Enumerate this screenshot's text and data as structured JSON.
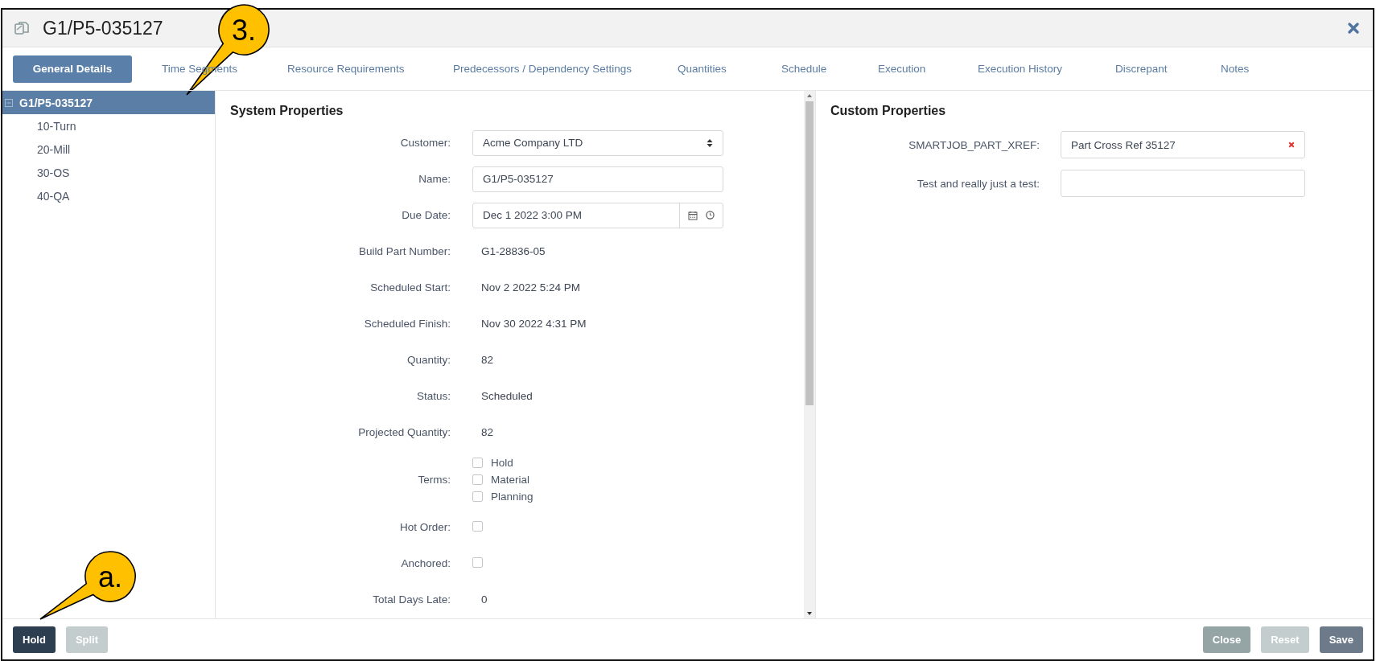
{
  "window": {
    "title": "G1/P5-035127"
  },
  "tabs": [
    {
      "label": "General Details",
      "selected": true
    },
    {
      "label": "Time Segments",
      "selected": false
    },
    {
      "label": "Resource Requirements",
      "selected": false
    },
    {
      "label": "Predecessors / Dependency Settings",
      "selected": false
    },
    {
      "label": "Quantities",
      "selected": false
    },
    {
      "label": "Schedule",
      "selected": false
    },
    {
      "label": "Execution",
      "selected": false
    },
    {
      "label": "Execution History",
      "selected": false
    },
    {
      "label": "Discrepant",
      "selected": false
    },
    {
      "label": "Notes",
      "selected": false
    }
  ],
  "tree": [
    {
      "label": "G1/P5-035127",
      "selected": true,
      "expanded": true,
      "children": [
        {
          "label": "10-Turn",
          "selected": false
        },
        {
          "label": "20-Mill",
          "selected": false
        },
        {
          "label": "30-OS",
          "selected": false
        },
        {
          "label": "40-QA",
          "selected": false
        }
      ]
    }
  ],
  "system_properties": {
    "title": "System Properties",
    "rows": [
      {
        "kind": "select",
        "label": "Customer:",
        "value": "Acme Company LTD"
      },
      {
        "kind": "text",
        "label": "Name:",
        "value": "G1/P5-035127"
      },
      {
        "kind": "datetime",
        "label": "Due Date:",
        "value": "Dec 1 2022 3:00 PM"
      },
      {
        "kind": "readonly",
        "label": "Build Part Number:",
        "value": "G1-28836-05"
      },
      {
        "kind": "readonly",
        "label": "Scheduled Start:",
        "value": "Nov 2 2022 5:24 PM"
      },
      {
        "kind": "readonly",
        "label": "Scheduled Finish:",
        "value": "Nov 30 2022 4:31 PM"
      },
      {
        "kind": "readonly",
        "label": "Quantity:",
        "value": "82"
      },
      {
        "kind": "readonly",
        "label": "Status:",
        "value": "Scheduled"
      },
      {
        "kind": "readonly",
        "label": "Projected Quantity:",
        "value": "82"
      },
      {
        "kind": "checklist",
        "label": "Terms:",
        "options": [
          {
            "label": "Hold",
            "checked": false
          },
          {
            "label": "Material",
            "checked": false
          },
          {
            "label": "Planning",
            "checked": false
          }
        ]
      },
      {
        "kind": "checkbox",
        "label": "Hot Order:",
        "checked": false
      },
      {
        "kind": "checkbox",
        "label": "Anchored:",
        "checked": false
      },
      {
        "kind": "readonly",
        "label": "Total Days Late:",
        "value": "0"
      }
    ]
  },
  "custom_properties": {
    "title": "Custom Properties",
    "rows": [
      {
        "label": "SMARTJOB_PART_XREF:",
        "value": "Part Cross Ref 35127",
        "clearable": true
      },
      {
        "label": "Test and really just a test:",
        "value": "",
        "clearable": false
      }
    ]
  },
  "buttons_left": [
    {
      "label": "Hold",
      "kind": "primary",
      "disabled": false
    },
    {
      "label": "Split",
      "kind": "secondary",
      "disabled": true
    }
  ],
  "buttons_right": [
    {
      "label": "Close",
      "kind": "secondary",
      "disabled": false
    },
    {
      "label": "Reset",
      "kind": "secondary",
      "disabled": true
    },
    {
      "label": "Save",
      "kind": "default",
      "disabled": false
    }
  ],
  "callouts": [
    {
      "label": "3."
    },
    {
      "label": "a."
    }
  ]
}
